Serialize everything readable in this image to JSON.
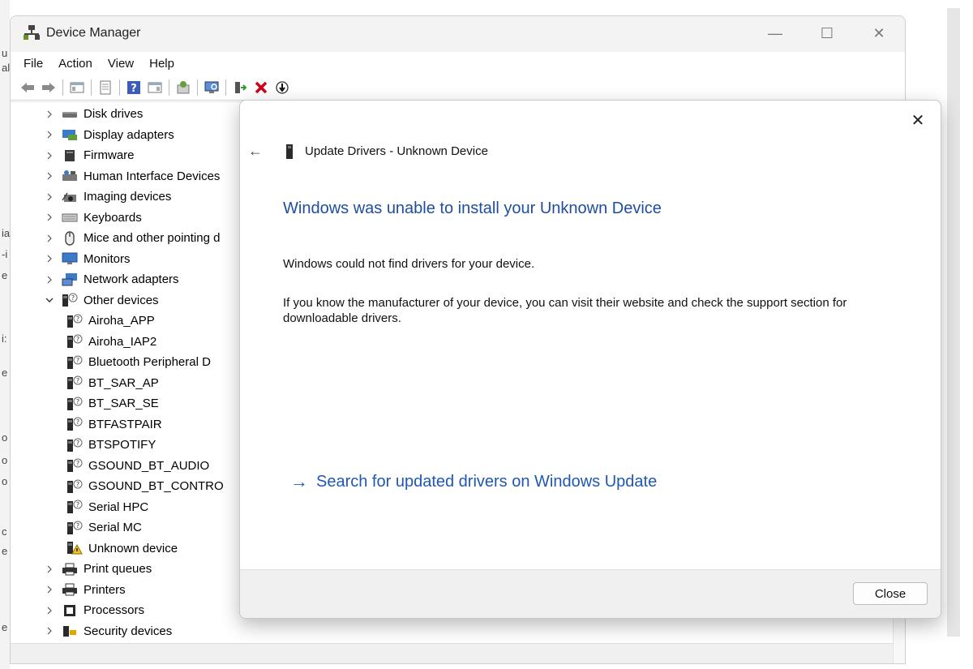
{
  "window": {
    "title": "Device Manager",
    "minimize_glyph": "—",
    "maximize_glyph": "☐",
    "close_glyph": "✕"
  },
  "menu": [
    "File",
    "Action",
    "View",
    "Help"
  ],
  "toolbar_icons": [
    "back-arrow-icon",
    "forward-arrow-icon",
    "show-hide-console-tree-icon",
    "properties-icon",
    "help-icon",
    "show-action-pane-icon",
    "update-driver-icon",
    "scan-hardware-icon",
    "enable-device-icon",
    "uninstall-device-icon",
    "disable-device-icon"
  ],
  "tree": {
    "rows": [
      {
        "label": "Disk drives",
        "expanded": false,
        "level": 0,
        "icon": "disk-drive-icon"
      },
      {
        "label": "Display adapters",
        "expanded": false,
        "level": 0,
        "icon": "display-adapter-icon"
      },
      {
        "label": "Firmware",
        "expanded": false,
        "level": 0,
        "icon": "firmware-icon"
      },
      {
        "label": "Human Interface Devices",
        "expanded": false,
        "level": 0,
        "icon": "hid-icon"
      },
      {
        "label": "Imaging devices",
        "expanded": false,
        "level": 0,
        "icon": "camera-icon"
      },
      {
        "label": "Keyboards",
        "expanded": false,
        "level": 0,
        "icon": "keyboard-icon"
      },
      {
        "label": "Mice and other pointing d",
        "expanded": false,
        "level": 0,
        "icon": "mouse-icon"
      },
      {
        "label": "Monitors",
        "expanded": false,
        "level": 0,
        "icon": "monitor-icon"
      },
      {
        "label": "Network adapters",
        "expanded": false,
        "level": 0,
        "icon": "network-adapter-icon"
      },
      {
        "label": "Other devices",
        "expanded": true,
        "level": 0,
        "icon": "unknown-device-icon"
      },
      {
        "label": "Airoha_APP",
        "level": 1,
        "icon": "unknown-device-icon"
      },
      {
        "label": "Airoha_IAP2",
        "level": 1,
        "icon": "unknown-device-icon"
      },
      {
        "label": "Bluetooth Peripheral D",
        "level": 1,
        "icon": "unknown-device-icon"
      },
      {
        "label": "BT_SAR_AP",
        "level": 1,
        "icon": "unknown-device-icon"
      },
      {
        "label": "BT_SAR_SE",
        "level": 1,
        "icon": "unknown-device-icon"
      },
      {
        "label": "BTFASTPAIR",
        "level": 1,
        "icon": "unknown-device-icon"
      },
      {
        "label": "BTSPOTIFY",
        "level": 1,
        "icon": "unknown-device-icon"
      },
      {
        "label": "GSOUND_BT_AUDIO",
        "level": 1,
        "icon": "unknown-device-icon"
      },
      {
        "label": "GSOUND_BT_CONTRO",
        "level": 1,
        "icon": "unknown-device-icon"
      },
      {
        "label": "Serial HPC",
        "level": 1,
        "icon": "unknown-device-icon"
      },
      {
        "label": "Serial MC",
        "level": 1,
        "icon": "unknown-device-icon"
      },
      {
        "label": "Unknown device",
        "level": 1,
        "icon": "warning-device-icon"
      },
      {
        "label": "Print queues",
        "expanded": false,
        "level": 0,
        "icon": "printer-icon"
      },
      {
        "label": "Printers",
        "expanded": false,
        "level": 0,
        "icon": "printer-icon"
      },
      {
        "label": "Processors",
        "expanded": false,
        "level": 0,
        "icon": "processor-icon"
      },
      {
        "label": "Security devices",
        "expanded": false,
        "level": 0,
        "icon": "security-device-icon"
      }
    ]
  },
  "dialog": {
    "close_glyph": "✕",
    "back_glyph": "←",
    "title": "Update Drivers - Unknown Device",
    "heading": "Windows was unable to install your Unknown Device",
    "text1": "Windows could not find drivers for your device.",
    "text2": "If you know the manufacturer of your device, you can visit their website and check the support section for downloadable drivers.",
    "link_arrow": "→",
    "link": "Search for updated drivers on Windows Update",
    "close_button": "Close"
  },
  "background_clipped_chars": [
    "u",
    "al",
    "ia",
    "-i",
    "e",
    "i:",
    "e",
    "o",
    "o",
    "o",
    "c",
    "e",
    "e"
  ],
  "colors": {
    "heading_blue": "#1f4ea0",
    "link_blue": "#1f58b3",
    "error_red": "#d0021b"
  }
}
